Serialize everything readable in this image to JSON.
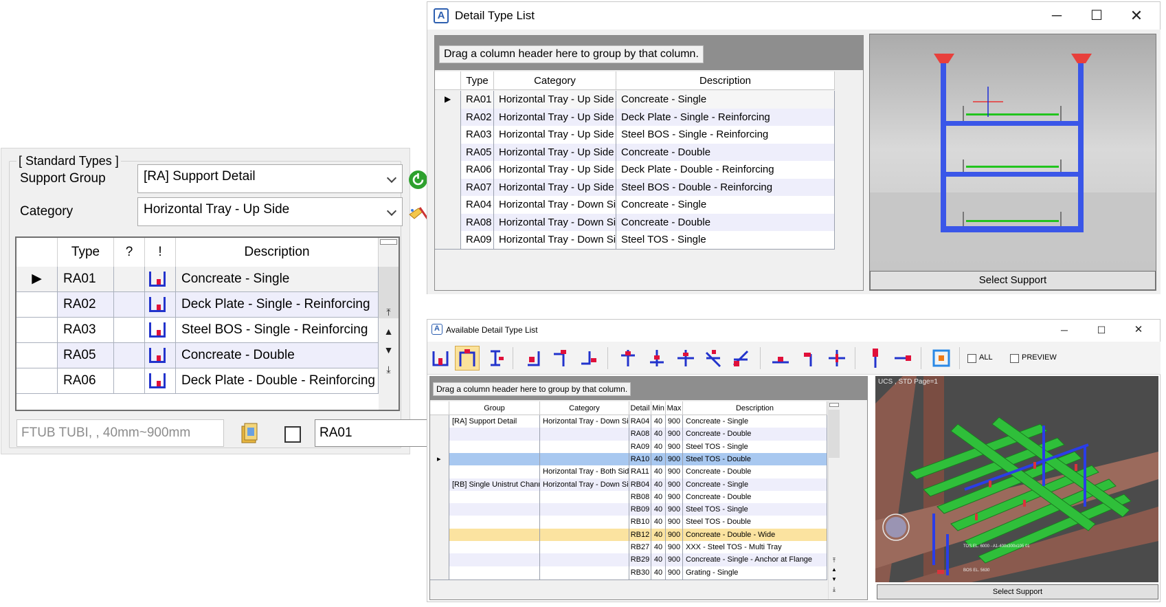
{
  "standard_types": {
    "legend": "[ Standard Types ]",
    "support_group_label": "Support Group",
    "support_group_value": "[RA] Support Detail",
    "category_label": "Category",
    "category_value": "Horizontal Tray - Up Side",
    "grid": {
      "headers": {
        "type": "Type",
        "question": "?",
        "exclaim": "!",
        "description": "Description"
      },
      "rows": [
        {
          "type": "RA01",
          "description": "Concreate - Single"
        },
        {
          "type": "RA02",
          "description": "Deck Plate - Single - Reinforcing"
        },
        {
          "type": "RA03",
          "description": "Steel BOS - Single - Reinforcing"
        },
        {
          "type": "RA05",
          "description": "Concreate - Double"
        },
        {
          "type": "RA06",
          "description": "Deck Plate - Double - Reinforcing"
        }
      ]
    },
    "pipe_field_value": "FTUB TUBI, , 40mm~900mm",
    "selected_type_value": "RA01"
  },
  "detail_type_list": {
    "title": "Detail Type List",
    "group_prompt": "Drag a column header here to group by that column.",
    "headers": {
      "type": "Type",
      "category": "Category",
      "description": "Description"
    },
    "rows": [
      {
        "type": "RA01",
        "category": "Horizontal Tray - Up Side",
        "description": "Concreate - Single"
      },
      {
        "type": "RA02",
        "category": "Horizontal Tray - Up Side",
        "description": "Deck Plate - Single - Reinforcing"
      },
      {
        "type": "RA03",
        "category": "Horizontal Tray - Up Side",
        "description": "Steel BOS - Single - Reinforcing"
      },
      {
        "type": "RA05",
        "category": "Horizontal Tray - Up Side",
        "description": "Concreate - Double"
      },
      {
        "type": "RA06",
        "category": "Horizontal Tray - Up Side",
        "description": "Deck Plate - Double - Reinforcing"
      },
      {
        "type": "RA07",
        "category": "Horizontal Tray - Up Side",
        "description": "Steel BOS - Double - Reinforcing"
      },
      {
        "type": "RA04",
        "category": "Horizontal Tray - Down Side",
        "description": "Concreate - Single"
      },
      {
        "type": "RA08",
        "category": "Horizontal Tray - Down Side",
        "description": "Concreate - Double"
      },
      {
        "type": "RA09",
        "category": "Horizontal Tray - Down Side",
        "description": "Steel TOS - Single"
      }
    ],
    "select_button": "Select Support"
  },
  "available_detail_type_list": {
    "title": "Available Detail Type List",
    "all_label": "ALL",
    "preview_label": "PREVIEW",
    "group_prompt": "Drag a column header here to group by that column.",
    "headers": {
      "group": "Group",
      "category": "Category",
      "detail": "Detail",
      "min": "Min",
      "max": "Max",
      "description": "Description"
    },
    "rows": [
      {
        "group": "[RA] Support Detail",
        "category": "Horizontal Tray - Down Side",
        "detail": "RA04",
        "min": "40",
        "max": "900",
        "description": "Concreate - Single"
      },
      {
        "group": "",
        "category": "",
        "detail": "RA08",
        "min": "40",
        "max": "900",
        "description": "Concreate - Double"
      },
      {
        "group": "",
        "category": "",
        "detail": "RA09",
        "min": "40",
        "max": "900",
        "description": "Steel TOS - Single"
      },
      {
        "group": "",
        "category": "",
        "detail": "RA10",
        "min": "40",
        "max": "900",
        "description": "Steel TOS - Double"
      },
      {
        "group": "",
        "category": "Horizontal Tray - Both Side",
        "detail": "RA11",
        "min": "40",
        "max": "900",
        "description": "Concreate - Double"
      },
      {
        "group": "[RB] Single Unistrut Channel",
        "category": "Horizontal Tray - Down Side",
        "detail": "RB04",
        "min": "40",
        "max": "900",
        "description": "Concreate - Single"
      },
      {
        "group": "",
        "category": "",
        "detail": "RB08",
        "min": "40",
        "max": "900",
        "description": "Concreate - Double"
      },
      {
        "group": "",
        "category": "",
        "detail": "RB09",
        "min": "40",
        "max": "900",
        "description": "Steel TOS - Single"
      },
      {
        "group": "",
        "category": "",
        "detail": "RB10",
        "min": "40",
        "max": "900",
        "description": "Steel TOS - Double"
      },
      {
        "group": "",
        "category": "",
        "detail": "RB12",
        "min": "40",
        "max": "900",
        "description": "Concreate - Double - Wide"
      },
      {
        "group": "",
        "category": "",
        "detail": "RB27",
        "min": "40",
        "max": "900",
        "description": "XXX - Steel TOS - Multi Tray"
      },
      {
        "group": "",
        "category": "",
        "detail": "RB29",
        "min": "40",
        "max": "900",
        "description": "Concreate - Single - Anchor at Flange"
      },
      {
        "group": "",
        "category": "",
        "detail": "RB30",
        "min": "40",
        "max": "900",
        "description": "Grating - Single"
      }
    ],
    "view_caption": "UCS , STD Page=1",
    "view_label_1": "TOS EL. 6000 - A1-400x300x105 01",
    "view_label_2": "BOS EL. 5630",
    "select_button": "Select Support",
    "colors": {
      "selected_row": "#a8c8f0",
      "highlight_row": "#fbe3a0"
    }
  }
}
